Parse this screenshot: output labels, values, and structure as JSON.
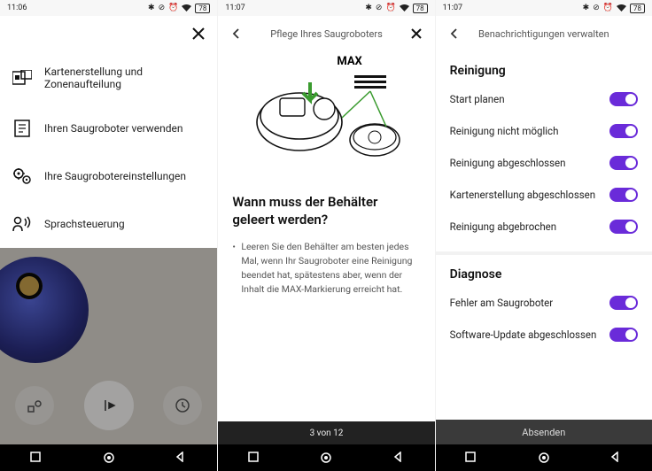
{
  "status": {
    "p1_time": "11:06",
    "p2_time": "11:07",
    "p3_time": "11:07",
    "battery": "78"
  },
  "panel1": {
    "menu": [
      {
        "label": "Kartenerstellung und Zonenaufteilung"
      },
      {
        "label": "Ihren Saugroboter verwenden"
      },
      {
        "label": "Ihre Saugrobotereinstellungen"
      },
      {
        "label": "Sprachsteuerung"
      }
    ]
  },
  "panel2": {
    "title": "Pflege Ihres Saugroboters",
    "max_label": "MAX",
    "heading": "Wann muss der Behälter geleert werden?",
    "bullet": "Leeren Sie den Behälter am besten jedes Mal, wenn Ihr Saugroboter eine Reinigung beendet hat, spätestens aber, wenn der Inhalt die MAX-Markierung erreicht hat.",
    "pager": "3 von 12"
  },
  "panel3": {
    "title": "Benachrichtigungen verwalten",
    "section1": "Reinigung",
    "rows1": [
      "Start planen",
      "Reinigung nicht möglich",
      "Reinigung abgeschlossen",
      "Kartenerstellung abgeschlossen",
      "Reinigung abgebrochen"
    ],
    "section2": "Diagnose",
    "rows2": [
      "Fehler am Saugroboter",
      "Software-Update abgeschlossen"
    ],
    "submit": "Absenden"
  }
}
